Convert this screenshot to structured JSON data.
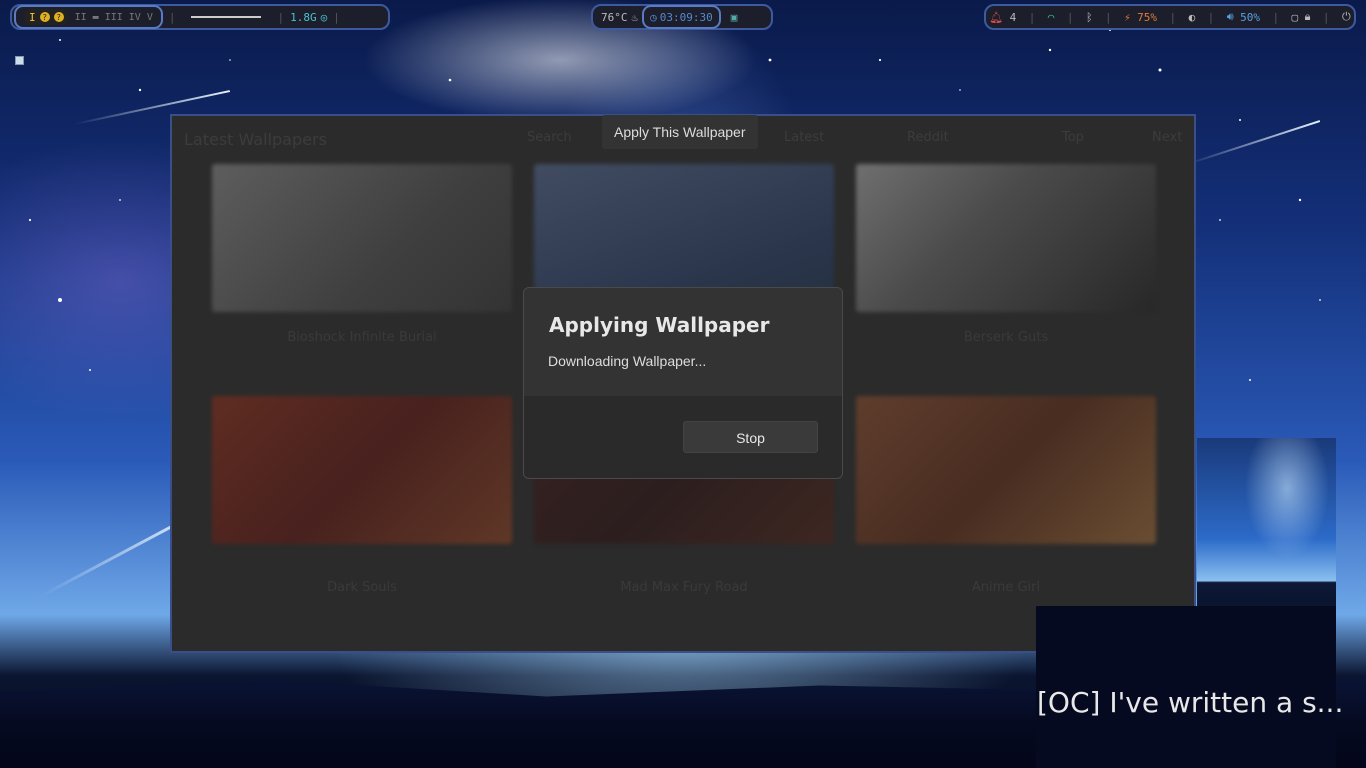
{
  "topbar": {
    "workspaces": {
      "active": "I",
      "others": [
        "II",
        "III",
        "IV",
        "V"
      ]
    },
    "ram": "1.8G",
    "temperature": "76°C",
    "clock": "03:09:30",
    "notifications_count": "4",
    "battery": "75%",
    "volume": "50%"
  },
  "window": {
    "title": "Latest Wallpapers",
    "headers": [
      "Search",
      "Latest",
      "Reddit",
      "Top",
      "Next"
    ],
    "captions": [
      "Bioshock Infinite Burial",
      "",
      "Berserk Guts",
      "Dark Souls",
      "Mad Max Fury Road",
      "Anime Girl"
    ]
  },
  "tooltip": "Apply This Wallpaper",
  "dialog": {
    "title": "Applying Wallpaper",
    "message": "Downloading Wallpaper...",
    "stop_label": "Stop"
  },
  "notification": {
    "text": "[OC] I've written a s..."
  },
  "colors": {
    "accent": "#3d5a9e",
    "battery": "#e07a3a",
    "volume": "#5aa0e0",
    "wifi": "#2ec07a"
  }
}
